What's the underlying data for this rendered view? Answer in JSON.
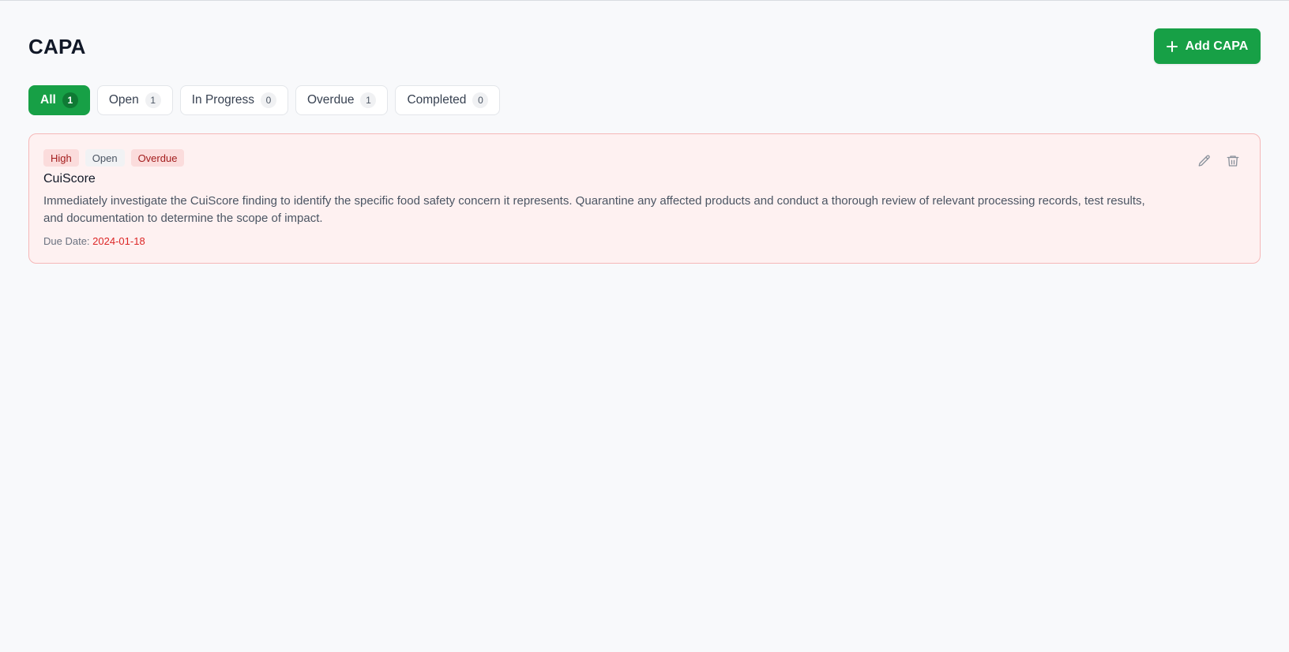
{
  "header": {
    "title": "CAPA",
    "add_button_label": "Add CAPA"
  },
  "tabs": [
    {
      "label": "All",
      "count": "1",
      "active": true
    },
    {
      "label": "Open",
      "count": "1",
      "active": false
    },
    {
      "label": "In Progress",
      "count": "0",
      "active": false
    },
    {
      "label": "Overdue",
      "count": "1",
      "active": false
    },
    {
      "label": "Completed",
      "count": "0",
      "active": false
    }
  ],
  "capa_items": [
    {
      "badges": {
        "priority": "High",
        "status": "Open",
        "flag": "Overdue"
      },
      "title": "CuiScore",
      "description": "Immediately investigate the CuiScore finding to identify the specific food safety concern it represents. Quarantine any affected products and conduct a thorough review of relevant processing records, test results, and documentation to determine the scope of impact.",
      "due_label": "Due Date:",
      "due_date": "2024-01-18",
      "icons": [
        "edit-icon",
        "trash-icon"
      ]
    }
  ],
  "colors": {
    "accent": "#17a046",
    "overdue_card_bg": "#fef1f1",
    "overdue_card_border": "#f5b8b8",
    "due_date": "#dc2626",
    "page_bg": "#f8f9fb"
  }
}
